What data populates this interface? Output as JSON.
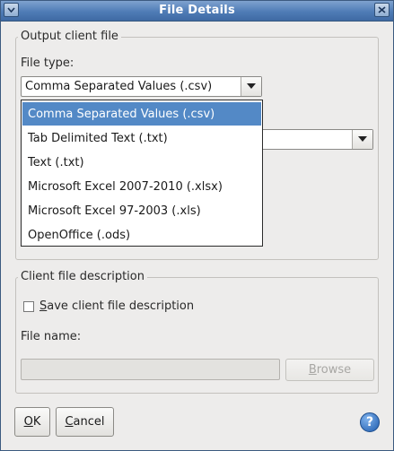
{
  "window": {
    "title": "File Details"
  },
  "output_group": {
    "legend": "Output client file",
    "file_type_label": "File type:",
    "file_type_selected": "Comma Separated Values (.csv)",
    "file_type_options": [
      "Comma Separated Values (.csv)",
      "Tab Delimited Text (.txt)",
      "Text (.txt)",
      "Microsoft Excel 2007-2010 (.xlsx)",
      "Microsoft Excel 97-2003 (.xls)",
      "OpenOffice (.ods)"
    ],
    "second_combo_value": ""
  },
  "description_group": {
    "legend": "Client file description",
    "save_checkbox_label": "Save client file description",
    "save_checked": false,
    "file_name_label": "File name:",
    "file_name_value": "",
    "browse_label": "Browse"
  },
  "footer": {
    "ok_label": "OK",
    "cancel_label": "Cancel",
    "help_glyph": "?"
  }
}
